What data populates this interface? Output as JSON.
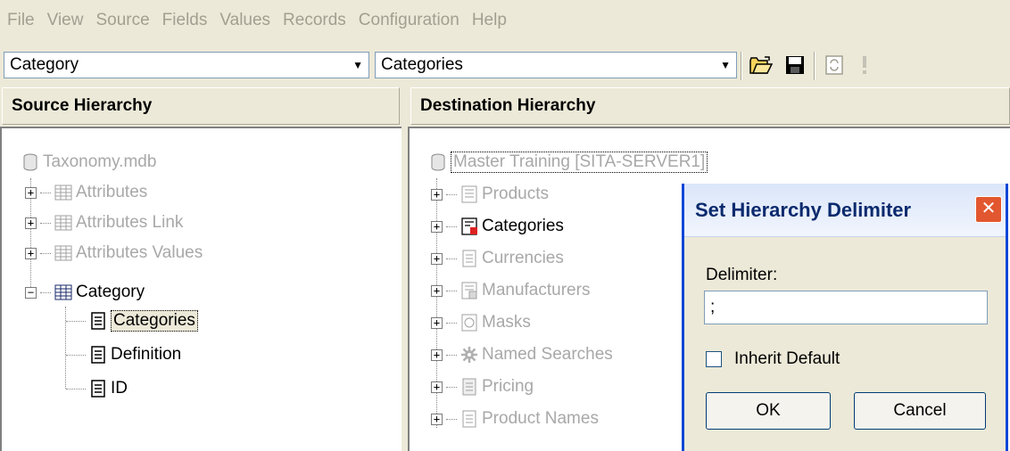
{
  "menu": [
    "File",
    "View",
    "Source",
    "Fields",
    "Values",
    "Records",
    "Configuration",
    "Help"
  ],
  "toolbar": {
    "source_table": "Category",
    "destination_table": "Categories",
    "icons": [
      "open-folder-icon",
      "save-icon",
      "refresh-icon",
      "exclamation-icon"
    ]
  },
  "source": {
    "header": "Source Hierarchy",
    "root": "Taxonomy.mdb",
    "items": [
      {
        "label": "Attributes"
      },
      {
        "label": "Attributes Link"
      },
      {
        "label": "Attributes Values"
      },
      {
        "label": "Category"
      }
    ],
    "children": [
      {
        "label": "Categories"
      },
      {
        "label": "Definition"
      },
      {
        "label": "ID"
      }
    ]
  },
  "destination": {
    "header": "Destination Hierarchy",
    "root": "Master Training [SITA-SERVER1]",
    "items": [
      {
        "label": "Products"
      },
      {
        "label": "Categories"
      },
      {
        "label": "Currencies"
      },
      {
        "label": "Manufacturers"
      },
      {
        "label": "Masks"
      },
      {
        "label": "Named Searches"
      },
      {
        "label": "Pricing"
      },
      {
        "label": "Product Names"
      }
    ]
  },
  "dialog": {
    "title": "Set Hierarchy Delimiter",
    "delimiter_label": "Delimiter:",
    "delimiter_value": ";",
    "inherit_label": "Inherit Default",
    "inherit_checked": false,
    "ok_label": "OK",
    "cancel_label": "Cancel"
  },
  "colors": {
    "background": "#ece9d8",
    "disabled_text": "#a8a8a8",
    "close_button": "#e2572f",
    "title_text": "#0a2a6e"
  }
}
